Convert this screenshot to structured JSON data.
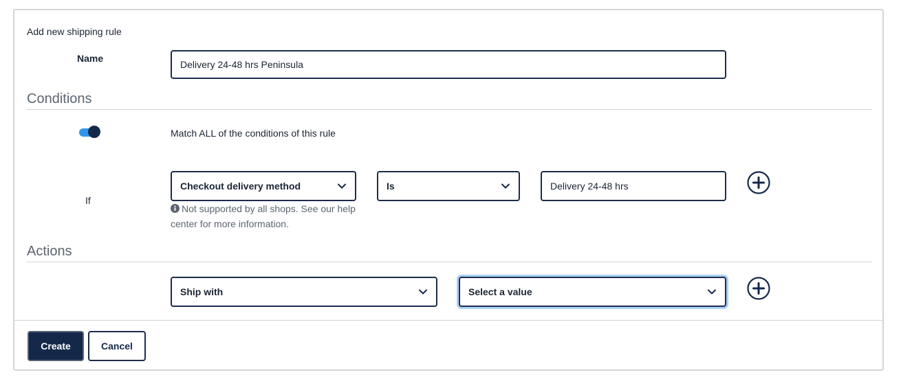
{
  "form": {
    "title": "Add new shipping rule",
    "name_label": "Name",
    "name_value": "Delivery 24-48 hrs Peninsula"
  },
  "conditions": {
    "section_title": "Conditions",
    "match_all_enabled": true,
    "match_label": "Match ALL of the conditions of this rule",
    "if_label": "If",
    "field_select": "Checkout delivery method",
    "operator_select": "Is",
    "value": "Delivery 24-48 hrs",
    "note": "Not supported by all shops. See our help center for more information."
  },
  "actions": {
    "section_title": "Actions",
    "action_select": "Ship with",
    "value_select": "Select a value"
  },
  "footer": {
    "create_label": "Create",
    "cancel_label": "Cancel"
  },
  "colors": {
    "primary": "#14284a",
    "toggle_track": "#3196ea",
    "focus_ring": "#a9d1f7"
  }
}
